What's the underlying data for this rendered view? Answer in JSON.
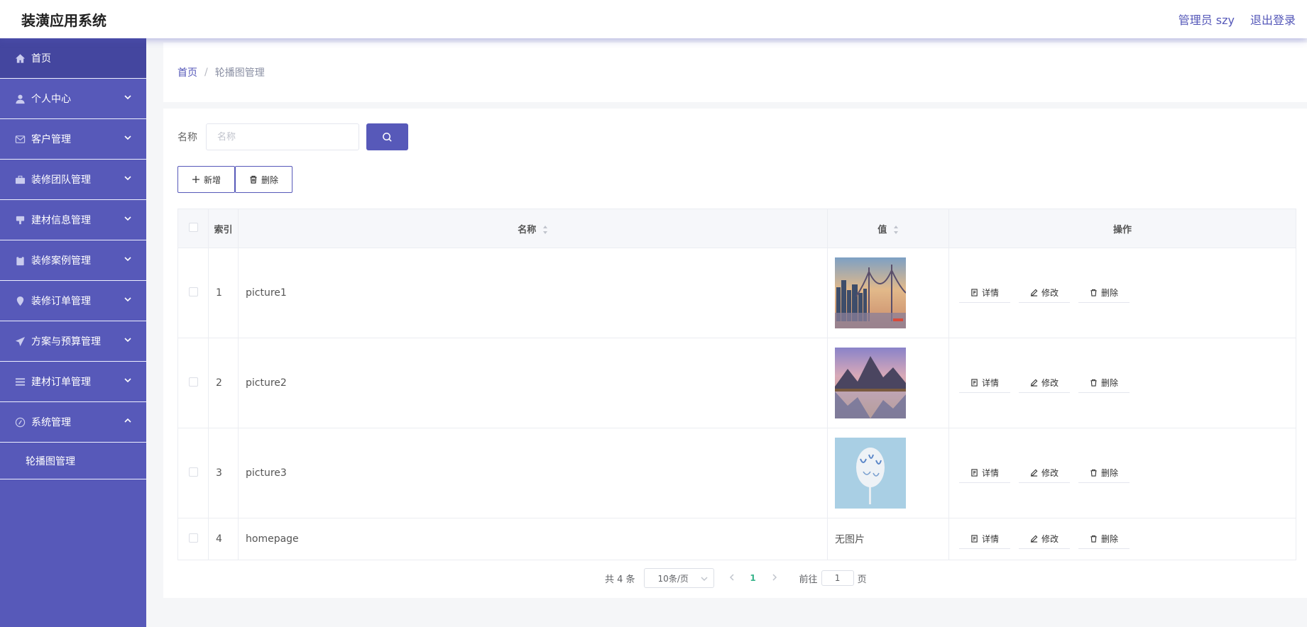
{
  "app": {
    "title": "装潢应用系统"
  },
  "header": {
    "user": "管理员 szy",
    "logout": "退出登录"
  },
  "sidebar": {
    "items": [
      {
        "label": "首页",
        "icon": "home-icon",
        "active": true,
        "expandable": false
      },
      {
        "label": "个人中心",
        "icon": "user-icon",
        "expandable": true
      },
      {
        "label": "客户管理",
        "icon": "mail-icon",
        "expandable": true
      },
      {
        "label": "装修团队管理",
        "icon": "briefcase-icon",
        "expandable": true
      },
      {
        "label": "建材信息管理",
        "icon": "stamp-icon",
        "expandable": true
      },
      {
        "label": "装修案例管理",
        "icon": "clipboard-icon",
        "expandable": true
      },
      {
        "label": "装修订单管理",
        "icon": "location-pin-icon",
        "expandable": true
      },
      {
        "label": "方案与预算管理",
        "icon": "paper-plane-icon",
        "expandable": true
      },
      {
        "label": "建材订单管理",
        "icon": "list-icon",
        "expandable": true
      },
      {
        "label": "系统管理",
        "icon": "compass-icon",
        "expandable": true,
        "expanded": true
      }
    ],
    "subitems": [
      {
        "label": "轮播图管理"
      }
    ]
  },
  "breadcrumb": {
    "home": "首页",
    "sep": "/",
    "current": "轮播图管理"
  },
  "search": {
    "label": "名称",
    "placeholder": "名称",
    "value": ""
  },
  "actions": {
    "add": "新增",
    "delete": "删除"
  },
  "table": {
    "headers": {
      "index": "索引",
      "name": "名称",
      "value": "值",
      "ops": "操作"
    },
    "rows": [
      {
        "index": "1",
        "name": "picture1",
        "image": "city-bridge"
      },
      {
        "index": "2",
        "name": "picture2",
        "image": "mountain-lake"
      },
      {
        "index": "3",
        "name": "picture3",
        "image": "white-flower"
      },
      {
        "index": "4",
        "name": "homepage",
        "no_image": "无图片"
      }
    ],
    "row_actions": {
      "detail": "详情",
      "edit": "修改",
      "delete": "删除"
    }
  },
  "pagination": {
    "total": "共 4 条",
    "page_size": "10条/页",
    "current_page": "1",
    "goto_prefix": "前往",
    "goto_value": "1",
    "goto_suffix": "页"
  },
  "colors": {
    "accent": "#5759b9",
    "active_menu": "#44469f",
    "page_active": "#38b48b"
  }
}
